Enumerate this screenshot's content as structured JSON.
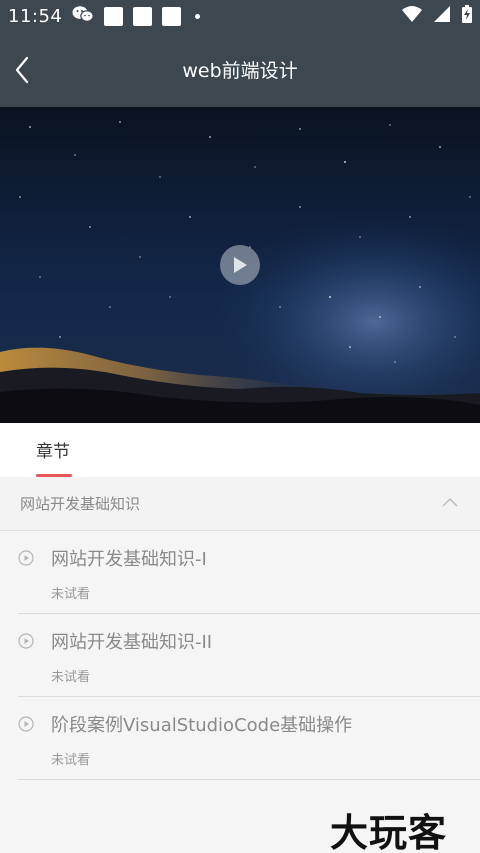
{
  "status_bar": {
    "time": "11:54",
    "icons": [
      "wechat-icon",
      "notification-icon",
      "notification-icon",
      "notification-icon",
      "dot-icon",
      "wifi-icon",
      "signal-icon",
      "battery-charging-icon"
    ]
  },
  "header": {
    "back_icon": "chevron-left-icon",
    "title": "web前端设计"
  },
  "video": {
    "play_icon": "play-icon"
  },
  "tabs": {
    "items": [
      {
        "label": "章节",
        "active": true
      }
    ],
    "accent_color": "#e8565a"
  },
  "section": {
    "title": "网站开发基础知识",
    "expanded": true
  },
  "lessons": [
    {
      "title": "网站开发基础知识-I",
      "status": "未试看"
    },
    {
      "title": "网站开发基础知识-II",
      "status": "未试看"
    },
    {
      "title": "阶段案例VisualStudioCode基础操作",
      "status": "未试看"
    }
  ],
  "watermark": "大玩客",
  "colors": {
    "header_bg": "#3d4750",
    "page_bg": "#f5f5f5"
  }
}
